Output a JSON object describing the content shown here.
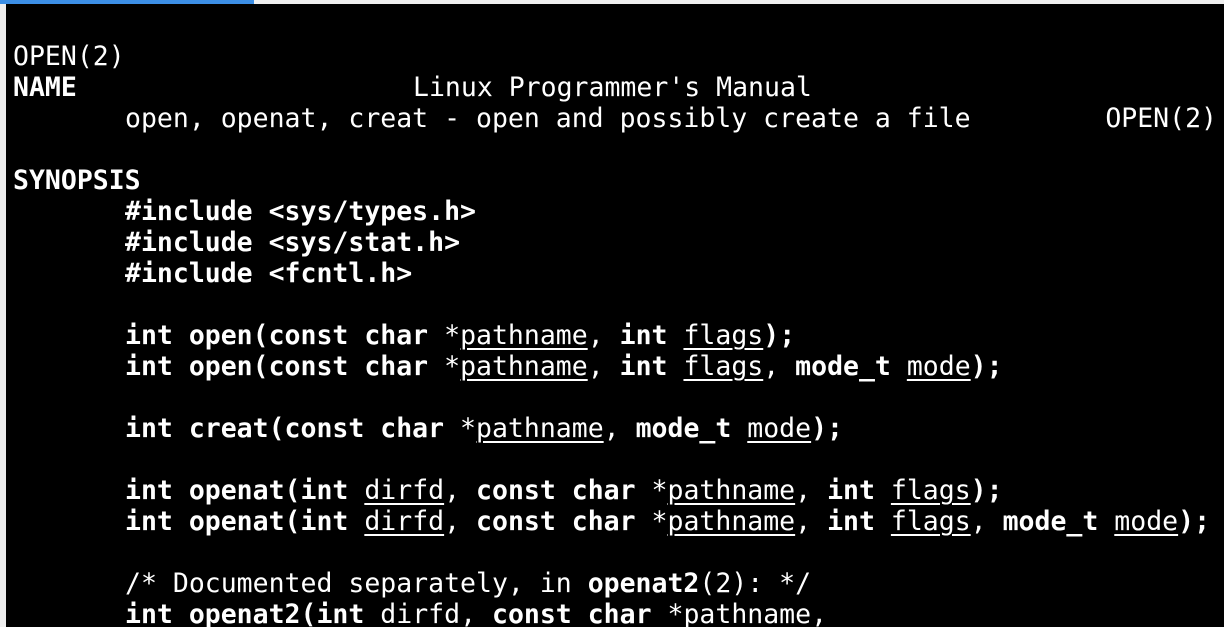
{
  "accent_color": "#3c8fe6",
  "header": {
    "left": "OPEN(2)",
    "center": "Linux Programmer's Manual",
    "right": "OPEN(2)"
  },
  "name_section": {
    "heading": "NAME",
    "text": "open, openat, creat - open and possibly create a file"
  },
  "synopsis": {
    "heading": "SYNOPSIS",
    "includes": [
      "#include <sys/types.h>",
      "#include <sys/stat.h>",
      "#include <fcntl.h>"
    ],
    "lines": [
      {
        "name": "open-flags",
        "tokens": [
          {
            "t": "int open(const char ",
            "s": "b"
          },
          {
            "t": "*",
            "s": ""
          },
          {
            "t": "pathname",
            "s": "u"
          },
          {
            "t": ", ",
            "s": ""
          },
          {
            "t": "int ",
            "s": "b"
          },
          {
            "t": "flags",
            "s": "u"
          },
          {
            "t": ");",
            "s": "b"
          }
        ]
      },
      {
        "name": "open-flags-mode",
        "tokens": [
          {
            "t": "int open(const char ",
            "s": "b"
          },
          {
            "t": "*",
            "s": ""
          },
          {
            "t": "pathname",
            "s": "u"
          },
          {
            "t": ", ",
            "s": ""
          },
          {
            "t": "int ",
            "s": "b"
          },
          {
            "t": "flags",
            "s": "u"
          },
          {
            "t": ", ",
            "s": ""
          },
          {
            "t": "mode_t ",
            "s": "b"
          },
          {
            "t": "mode",
            "s": "u"
          },
          {
            "t": ");",
            "s": "b"
          }
        ]
      },
      {
        "name": "blank",
        "tokens": []
      },
      {
        "name": "creat",
        "tokens": [
          {
            "t": "int creat(const char ",
            "s": "b"
          },
          {
            "t": "*",
            "s": ""
          },
          {
            "t": "pathname",
            "s": "u"
          },
          {
            "t": ", ",
            "s": ""
          },
          {
            "t": "mode_t ",
            "s": "b"
          },
          {
            "t": "mode",
            "s": "u"
          },
          {
            "t": ");",
            "s": "b"
          }
        ]
      },
      {
        "name": "blank",
        "tokens": []
      },
      {
        "name": "openat-flags",
        "tokens": [
          {
            "t": "int openat(int ",
            "s": "b"
          },
          {
            "t": "dirfd",
            "s": "u"
          },
          {
            "t": ", ",
            "s": ""
          },
          {
            "t": "const char ",
            "s": "b"
          },
          {
            "t": "*",
            "s": ""
          },
          {
            "t": "pathname",
            "s": "u"
          },
          {
            "t": ", ",
            "s": ""
          },
          {
            "t": "int ",
            "s": "b"
          },
          {
            "t": "flags",
            "s": "u"
          },
          {
            "t": ");",
            "s": "b"
          }
        ]
      },
      {
        "name": "openat-flags-mode",
        "tokens": [
          {
            "t": "int openat(int ",
            "s": "b"
          },
          {
            "t": "dirfd",
            "s": "u"
          },
          {
            "t": ", ",
            "s": ""
          },
          {
            "t": "const char ",
            "s": "b"
          },
          {
            "t": "*",
            "s": ""
          },
          {
            "t": "pathname",
            "s": "u"
          },
          {
            "t": ", ",
            "s": ""
          },
          {
            "t": "int ",
            "s": "b"
          },
          {
            "t": "flags",
            "s": "u"
          },
          {
            "t": ", ",
            "s": ""
          },
          {
            "t": "mode_t ",
            "s": "b"
          },
          {
            "t": "mode",
            "s": "u"
          },
          {
            "t": ");",
            "s": "b"
          }
        ]
      },
      {
        "name": "blank",
        "tokens": []
      },
      {
        "name": "openat2-comment",
        "tokens": [
          {
            "t": "/* Documented separately, in ",
            "s": ""
          },
          {
            "t": "openat2",
            "s": "b"
          },
          {
            "t": "(2): */",
            "s": ""
          }
        ]
      },
      {
        "name": "openat2",
        "tokens": [
          {
            "t": "int openat2(int ",
            "s": "b"
          },
          {
            "t": "dirfd",
            "s": "u"
          },
          {
            "t": ", ",
            "s": ""
          },
          {
            "t": "const char ",
            "s": "b"
          },
          {
            "t": "*",
            "s": ""
          },
          {
            "t": "pathname",
            "s": "u"
          },
          {
            "t": ",",
            "s": ""
          }
        ]
      }
    ]
  }
}
